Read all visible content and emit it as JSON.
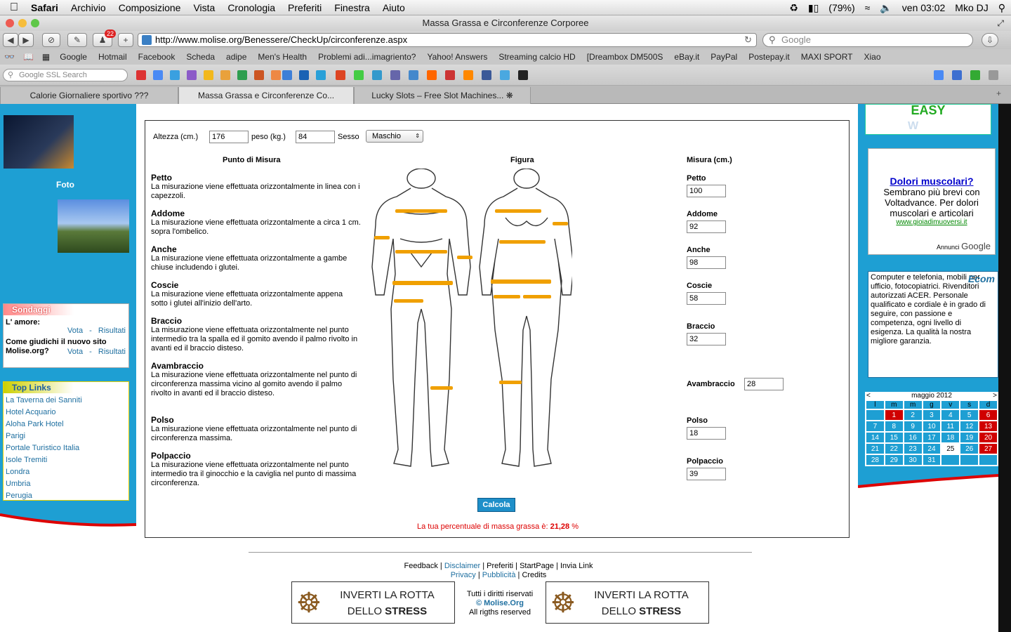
{
  "menubar": {
    "app": "Safari",
    "items": [
      "Archivio",
      "Composizione",
      "Vista",
      "Cronologia",
      "Preferiti",
      "Finestra",
      "Aiuto"
    ],
    "battery": "(79%)",
    "clock": "ven 03:02",
    "user": "Mko DJ"
  },
  "window": {
    "title": "Massa Grassa e Circonferenze Corporee"
  },
  "toolbar": {
    "url": "http://www.molise.org/Benessere/CheckUp/circonferenze.aspx",
    "search_placeholder": "Google",
    "badge": "22"
  },
  "bookmarks": [
    "Google",
    "Hotmail",
    "Facebook",
    "Scheda",
    "adipe",
    "Men's Health",
    "Problemi adi...imagriento?",
    "Yahoo! Answers",
    "Streaming calcio HD",
    "[Dreambox DM500S",
    "eBay.it",
    "PayPal",
    "Postepay.it",
    "MAXI SPORT",
    "Xiao"
  ],
  "google_toolbar": {
    "search_placeholder": "Google SSL Search"
  },
  "tabs": [
    "Calorie Giornaliere sportivo ???",
    "Massa Grassa e Circonferenze Co...",
    "Lucky Slots – Free Slot Machines..."
  ],
  "left": {
    "foto_label": "Foto",
    "sondaggi_title": "Sondaggi",
    "polls": [
      {
        "q": "L' amore:",
        "vota": "Vota",
        "risultati": "Risultati"
      },
      {
        "q": "Come giudichi il nuovo sito Molise.org?",
        "vota": "Vota",
        "risultati": "Risultati"
      }
    ],
    "sep": "-",
    "toplinks_title": "Top Links",
    "links": [
      "La Taverna dei Sanniti",
      "Hotel Acquario",
      "Aloha Park Hotel",
      "Parigi",
      "Portale Turistico Italia",
      "Isole Tremiti",
      "Londra",
      "Umbria",
      "Perugia"
    ]
  },
  "form": {
    "altezza_label": "Altezza (cm.)",
    "altezza": "176",
    "peso_label": "peso (kg.)",
    "peso": "84",
    "sesso_label": "Sesso",
    "sesso": "Maschio",
    "col_punto": "Punto di Misura",
    "col_figura": "Figura",
    "col_misura": "Misura (cm.)",
    "items": [
      {
        "name": "Petto",
        "desc": "La misurazione viene effettuata orizzontalmente in linea con i capezzoli.",
        "value": "100"
      },
      {
        "name": "Addome",
        "desc": "La misurazione viene effettuata orizzontalmente a circa 1 cm. sopra l'ombelico.",
        "value": "92"
      },
      {
        "name": "Anche",
        "desc": "La misurazione viene effettuata orizzontalmente a gambe chiuse includendo i glutei.",
        "value": "98"
      },
      {
        "name": "Coscie",
        "desc": "La misurazione viene effettuata orizzontalmente appena sotto i glutei all'inizio dell'arto.",
        "value": "58"
      },
      {
        "name": "Braccio",
        "desc": "La misurazione viene effettuata orizzontalmente nel punto intermedio tra la spalla ed il gomito avendo il palmo rivolto in avanti ed il braccio disteso.",
        "value": "32"
      },
      {
        "name": "Avambraccio",
        "desc": "La misurazione viene effettuata orizzontalmente nel punto di circonferenza massima vicino al gomito avendo il palmo rivolto in avanti ed il braccio disteso.",
        "value": "28"
      },
      {
        "name": "Polso",
        "desc": "La misurazione viene effettuata orizzontalmente nel punto di circonferenza massima.",
        "value": "18"
      },
      {
        "name": "Polpaccio",
        "desc": "La misurazione viene effettuata orizzontalmente nel punto intermedio tra il ginocchio e la caviglia nel punto di massima circonferenza.",
        "value": "39"
      }
    ],
    "calcola": "Calcola",
    "result_text": "La tua percentuale di massa grassa è:",
    "result_value": "21,28",
    "result_unit": "%"
  },
  "right": {
    "easy": "EASY",
    "ad_title": "Dolori muscolari?",
    "ad_body": "Sembrano più brevi con Voltadvance. Per dolori muscolari e articolari",
    "ad_url": "www.gioiadimuoversi.it",
    "ad_footer": "Annunci",
    "ad_google": "Google",
    "ecom_text": "Computer e telefonia, mobili per ufficio, fotocopiatrici. Rivenditori autorizzati ACER. Personale qualificato e cordiale è in grado di seguire, con passione e competenza, ogni livello di esigenza. La qualità la nostra migliore garanzia.",
    "ecom_logo": "Ecom",
    "calendar": {
      "month": "maggio 2012",
      "prev": "<",
      "next": ">",
      "days": [
        "l",
        "m",
        "m",
        "g",
        "v",
        "s",
        "d"
      ],
      "weeks": [
        [
          "",
          "1",
          "2",
          "3",
          "4",
          "5",
          "6"
        ],
        [
          "7",
          "8",
          "9",
          "10",
          "11",
          "12",
          "13"
        ],
        [
          "14",
          "15",
          "16",
          "17",
          "18",
          "19",
          "20"
        ],
        [
          "21",
          "22",
          "23",
          "24",
          "25",
          "26",
          "27"
        ],
        [
          "28",
          "29",
          "30",
          "31",
          "",
          "",
          ""
        ]
      ]
    }
  },
  "footer": {
    "links": [
      "Feedback",
      "Disclaimer",
      "Preferiti",
      "StartPage",
      "Invia Link"
    ],
    "links2": [
      "Privacy",
      "Pubblicità",
      "Credits"
    ],
    "sep": "|",
    "banner_line1": "INVERTI LA ROTTA",
    "banner_line2a": "DELLO",
    "banner_line2b": "STRESS",
    "rights1": "Tutti i diritti riservati",
    "rights_brand": "© Molise.Org",
    "rights2": "All rigths reserved"
  }
}
